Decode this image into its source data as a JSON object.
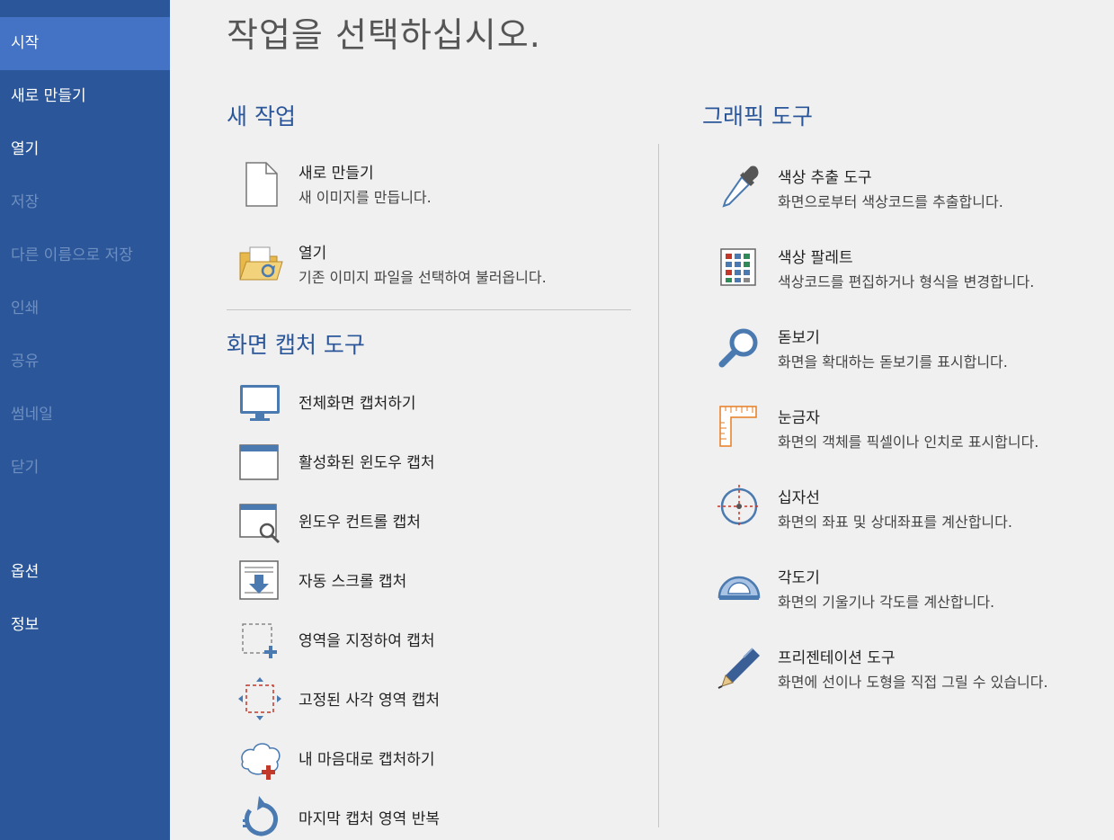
{
  "sidebar": {
    "items": [
      {
        "label": "시작",
        "state": "active"
      },
      {
        "label": "새로 만들기",
        "state": "normal"
      },
      {
        "label": "열기",
        "state": "normal"
      },
      {
        "label": "저장",
        "state": "disabled"
      },
      {
        "label": "다른 이름으로 저장",
        "state": "disabled"
      },
      {
        "label": "인쇄",
        "state": "disabled"
      },
      {
        "label": "공유",
        "state": "disabled"
      },
      {
        "label": "썸네일",
        "state": "disabled"
      },
      {
        "label": "닫기",
        "state": "disabled"
      },
      {
        "label": "옵션",
        "state": "normal"
      },
      {
        "label": "정보",
        "state": "normal"
      }
    ]
  },
  "main": {
    "title": "작업을 선택하십시오.",
    "new_task": {
      "title": "새 작업",
      "items": [
        {
          "name": "새로 만들기",
          "desc": "새 이미지를 만듭니다.",
          "icon": "new-file-icon"
        },
        {
          "name": "열기",
          "desc": "기존 이미지 파일을 선택하여 불러옵니다.",
          "icon": "open-folder-icon"
        }
      ]
    },
    "capture": {
      "title": "화면 캡처 도구",
      "items": [
        {
          "name": "전체화면 캡처하기",
          "icon": "monitor-icon"
        },
        {
          "name": "활성화된 윈도우 캡처",
          "icon": "window-icon"
        },
        {
          "name": "윈도우 컨트롤 캡처",
          "icon": "window-search-icon"
        },
        {
          "name": "자동 스크롤 캡처",
          "icon": "scroll-icon"
        },
        {
          "name": "영역을 지정하여 캡처",
          "icon": "region-plus-icon"
        },
        {
          "name": "고정된 사각 영역 캡처",
          "icon": "fixed-region-icon"
        },
        {
          "name": "내 마음대로 캡처하기",
          "icon": "freeform-icon"
        },
        {
          "name": "마지막 캡처 영역 반복",
          "icon": "repeat-icon"
        }
      ]
    },
    "graphic": {
      "title": "그래픽 도구",
      "items": [
        {
          "name": "색상 추출 도구",
          "desc": "화면으로부터 색상코드를 추출합니다.",
          "icon": "eyedropper-icon"
        },
        {
          "name": "색상 팔레트",
          "desc": "색상코드를 편집하거나 형식을 변경합니다.",
          "icon": "palette-icon"
        },
        {
          "name": "돋보기",
          "desc": "화면을 확대하는 돋보기를 표시합니다.",
          "icon": "magnifier-icon"
        },
        {
          "name": "눈금자",
          "desc": "화면의 객체를 픽셀이나 인치로 표시합니다.",
          "icon": "ruler-icon"
        },
        {
          "name": "십자선",
          "desc": "화면의 좌표 및 상대좌표를 계산합니다.",
          "icon": "crosshair-icon"
        },
        {
          "name": "각도기",
          "desc": "화면의 기울기나 각도를 계산합니다.",
          "icon": "protractor-icon"
        },
        {
          "name": "프리젠테이션 도구",
          "desc": "화면에 선이나 도형을 직접 그릴 수 있습니다.",
          "icon": "pen-icon"
        }
      ]
    }
  },
  "colors": {
    "sidebar_bg": "#2b579a",
    "sidebar_active": "#4472c4",
    "sidebar_disabled_text": "#6f8fc0",
    "accent": "#2b579a",
    "background": "#f0f0f0"
  }
}
